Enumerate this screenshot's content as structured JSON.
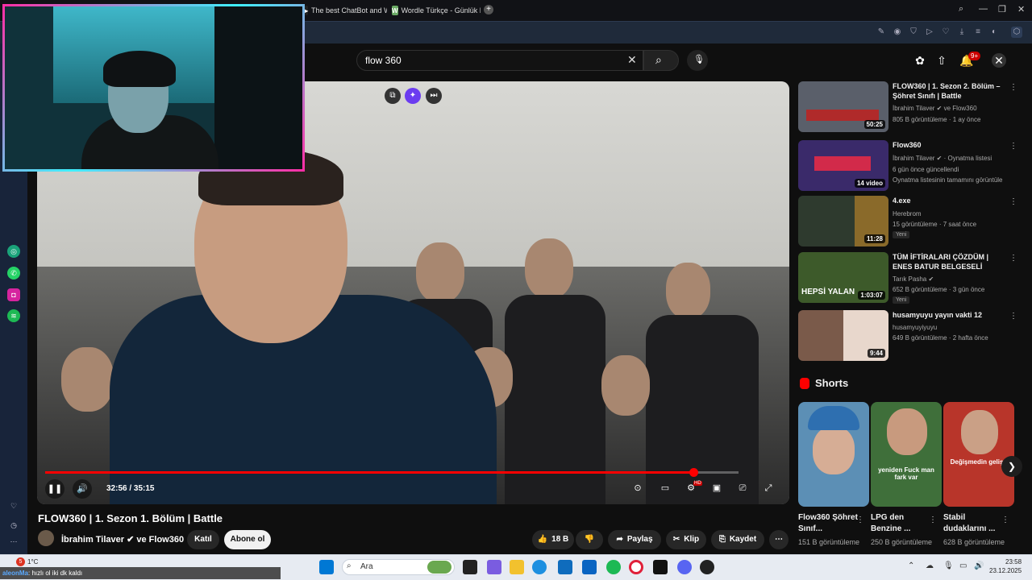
{
  "browser": {
    "tabs": [
      {
        "label": "The best ChatBot and Wi",
        "icon": "chatbot-tab-icon"
      },
      {
        "label": "Wordle Türkçe - Günlük K",
        "icon": "wordle-tab-icon",
        "favicon_letter": "W"
      }
    ],
    "new_tab": "+"
  },
  "youtube": {
    "search": {
      "value": "flow 360"
    },
    "notifications_badge": "9+"
  },
  "player": {
    "time": "32:56 / 35:15",
    "progress": 0.935
  },
  "video": {
    "title": "FLOW360 | 1. Sezon 1. Bölüm | Battle",
    "channel": "İbrahim Tilaver ✔ ve Flow360",
    "join_label": "Katıl",
    "subscribe_label": "Abone ol",
    "likes": "18 B",
    "share_label": "Paylaş",
    "clip_label": "Klip",
    "save_label": "Kaydet"
  },
  "recommendations": [
    {
      "title": "FLOW360 | 1. Sezon 2. Bölüm – Şöhret Sınıfı | Battle",
      "line1": "İbrahim Tilaver ✔ ve Flow360",
      "line2": "805 B görüntüleme · 1 ay önce",
      "duration": "50:25",
      "thumb": "#5a5f6a"
    },
    {
      "title": "Flow360",
      "line1": "İbrahim Tilaver ✔ · Oynatma listesi",
      "line2": "6 gün önce güncellendi",
      "line3": "Oynatma listesinin tamamını görüntüle",
      "duration": "14 video",
      "thumb": "#3a2a6a"
    },
    {
      "title": "4.exe",
      "line1": "Herebrom",
      "line2": "15 görüntüleme · 7 saat önce",
      "badge": "Yeni",
      "duration": "11:28",
      "thumb": "#2e3a2e"
    },
    {
      "title": "TÜM İFTİRALARI ÇÖZDÜM | ENES BATUR BELGESELİ",
      "line1": "Tarık Pasha ✔",
      "line2": "652 B görüntüleme · 3 gün önce",
      "badge": "Yeni",
      "duration": "1:03:07",
      "thumb_text": "HEPSİ YALAN",
      "thumb": "#3d5a2a"
    },
    {
      "title": "husamyuyu yayın vakti 12",
      "line1": "husamyuyiyuyu",
      "line2": "649 B görüntüleme · 2 hafta önce",
      "duration": "9:44",
      "thumb": "#7a5a4a"
    }
  ],
  "shorts": {
    "heading": "Shorts",
    "items": [
      {
        "title": "Flow360 Şöhret Sınıf...",
        "views": "151 B görüntüleme",
        "color": "#5c8fb5"
      },
      {
        "title": "LPG den Benzine ...",
        "views": "250 B görüntüleme",
        "color": "#3f6f3a",
        "overlay": "yeniden Fuck man fark var"
      },
      {
        "title": "Stabil dudaklarını ...",
        "views": "628 B görüntüleme",
        "color": "#b8352a",
        "overlay": "Değişmedin gelişti"
      }
    ]
  },
  "taskbar": {
    "weather": "1°C",
    "notif_count": "5",
    "search_placeholder": "Ara",
    "time": "23:58",
    "date": "23.12.2025",
    "chat_user": "aleonMa",
    "chat_text": ": hızlı ol iki dk kaldı"
  }
}
